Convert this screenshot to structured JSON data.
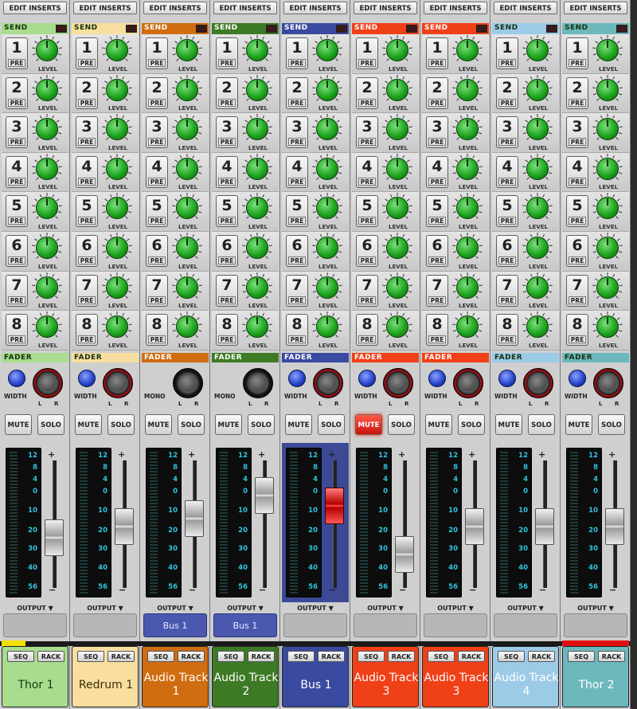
{
  "channels": [
    {
      "name": "Thor 1",
      "color": "#a8dc8e",
      "name_color": "#1a3a10",
      "send_dark": true,
      "pan": "width",
      "mute": false,
      "fader_level": 0.47,
      "output": "",
      "top_marker": "yellow"
    },
    {
      "name": "Redrum 1",
      "color": "#f8dfa0",
      "name_color": "#3a2a08",
      "send_dark": true,
      "pan": "width",
      "mute": false,
      "fader_level": 0.57,
      "output": "",
      "top_marker": ""
    },
    {
      "name": "Audio Track 1",
      "color": "#d06d10",
      "name_color": "#ffffff",
      "send_dark": false,
      "pan": "mono",
      "mute": false,
      "fader_level": 0.64,
      "output": "Bus 1",
      "top_marker": ""
    },
    {
      "name": "Audio Track 2",
      "color": "#3d7a25",
      "name_color": "#ffffff",
      "send_dark": false,
      "pan": "mono",
      "mute": false,
      "fader_level": 0.85,
      "output": "Bus 1",
      "top_marker": ""
    },
    {
      "name": "Bus 1",
      "color": "#3a4aa0",
      "name_color": "#ffffff",
      "send_dark": false,
      "pan": "width",
      "mute": false,
      "fader_level": 0.76,
      "output": "",
      "top_marker": "",
      "selected": true
    },
    {
      "name": "Audio Track 3",
      "color": "#f04018",
      "name_color": "#ffffff",
      "send_dark": false,
      "pan": "width",
      "mute": true,
      "fader_level": 0.32,
      "output": "",
      "top_marker": ""
    },
    {
      "name": "Audio Track 3",
      "color": "#f04018",
      "name_color": "#ffffff",
      "send_dark": false,
      "pan": "width",
      "mute": false,
      "fader_level": 0.57,
      "output": "",
      "top_marker": ""
    },
    {
      "name": "Audio Track 4",
      "color": "#9ccbe8",
      "name_color": "#ffffff",
      "send_dark": true,
      "pan": "width",
      "mute": false,
      "fader_level": 0.57,
      "output": "",
      "top_marker": ""
    },
    {
      "name": "Thor 2",
      "color": "#6cb8bc",
      "name_color": "#ffffff",
      "send_dark": true,
      "pan": "width",
      "mute": false,
      "fader_level": 0.57,
      "output": "",
      "top_marker": "red"
    }
  ],
  "labels": {
    "edit_inserts": "EDIT INSERTS",
    "send": "SEND",
    "fader": "FADER",
    "pre": "PRE",
    "level": "LEVEL",
    "width": "WIDTH",
    "mono": "MONO",
    "left": "L",
    "right": "R",
    "mute": "MUTE",
    "solo": "SOLO",
    "output": "OUTPUT ▼",
    "seq": "SEQ",
    "rack": "RACK",
    "plus": "+",
    "minus": "−"
  },
  "send_numbers": [
    "1",
    "2",
    "3",
    "4",
    "5",
    "6",
    "7",
    "8"
  ],
  "meter_scale": [
    "12",
    "8",
    "4",
    "0",
    "10",
    "20",
    "30",
    "40",
    "56"
  ]
}
